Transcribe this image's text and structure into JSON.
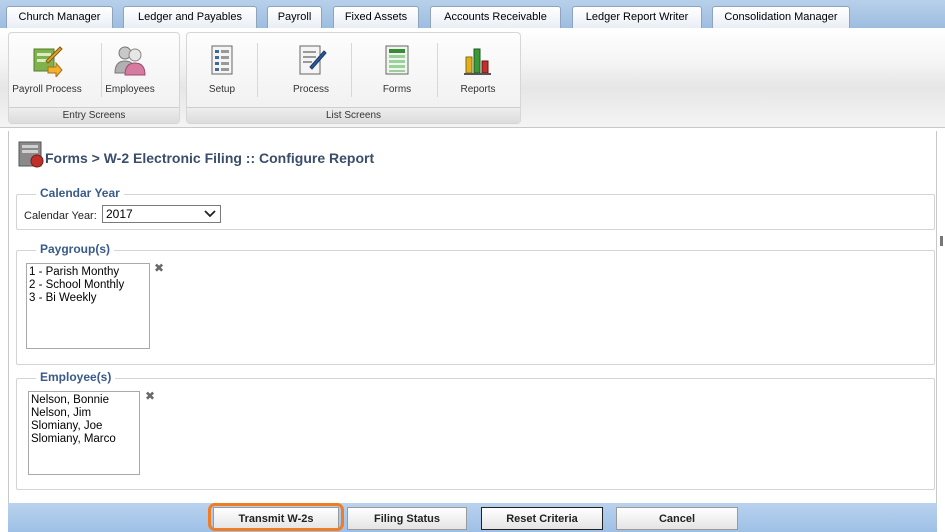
{
  "tabs": [
    {
      "label": "Church Manager"
    },
    {
      "label": "Ledger and Payables"
    },
    {
      "label": "Payroll"
    },
    {
      "label": "Fixed Assets"
    },
    {
      "label": "Accounts Receivable"
    },
    {
      "label": "Ledger Report Writer"
    },
    {
      "label": "Consolidation Manager"
    }
  ],
  "ribbon": {
    "entry_group": {
      "label": "Entry Screens",
      "buttons": [
        {
          "label": "Payroll Process",
          "icon": "payroll-process-icon"
        },
        {
          "label": "Employees",
          "icon": "employees-icon"
        }
      ]
    },
    "list_group": {
      "label": "List Screens",
      "buttons": [
        {
          "label": "Setup",
          "icon": "setup-icon"
        },
        {
          "label": "Process",
          "icon": "process-icon"
        },
        {
          "label": "Forms",
          "icon": "forms-icon"
        },
        {
          "label": "Reports",
          "icon": "reports-icon"
        }
      ]
    }
  },
  "page": {
    "title": "Forms > W-2 Electronic Filing :: Configure Report"
  },
  "calendar_year": {
    "legend": "Calendar Year",
    "label": "Calendar Year:",
    "value": "2017"
  },
  "paygroups": {
    "legend": "Paygroup(s)",
    "items": [
      "1 - Parish Monthy",
      "2 - School Monthly",
      "3 - Bi Weekly"
    ],
    "clear_icon": "✖"
  },
  "employees": {
    "legend": "Employee(s)",
    "items": [
      "Nelson, Bonnie",
      "Nelson, Jim",
      "Slomiany, Joe",
      "Slomiany, Marco"
    ],
    "clear_icon": "✖"
  },
  "buttons": {
    "transmit": "Transmit W-2s",
    "filing_status": "Filing Status",
    "reset": "Reset Criteria",
    "cancel": "Cancel"
  },
  "colors": {
    "accent": "#3a5a8a",
    "highlight": "#f07c23",
    "bar": "#a8c6e8"
  }
}
